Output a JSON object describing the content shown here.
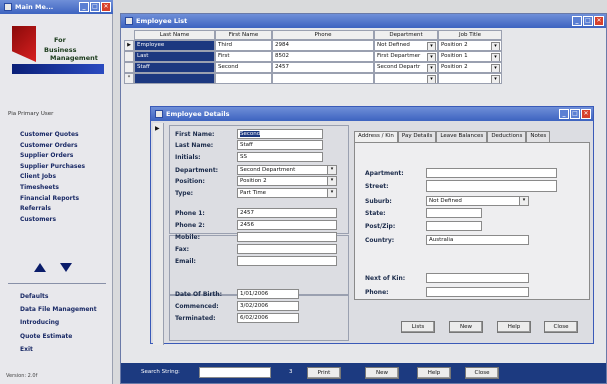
{
  "main": {
    "title": "Main Me...",
    "logo_lines": [
      "For",
      "Business",
      "Management"
    ],
    "user": "Pia Primary User",
    "menu": [
      "Customer Quotes",
      "Customer Orders",
      "Supplier Orders",
      "Supplier Purchases",
      "Client Jobs",
      "Timesheets",
      "Financial Reports",
      "Referrals",
      "Customers"
    ],
    "menu2": [
      "Defaults",
      "Data File Management",
      "Introducing",
      "Quote Estimate",
      "Exit"
    ],
    "version": "Version: 2.0f"
  },
  "list": {
    "title": "Employee List",
    "headers": [
      "Last Name",
      "First Name",
      "Phone",
      "Department",
      "Job Title"
    ],
    "rows": [
      {
        "last": "Employee",
        "first": "Third",
        "phone": "2984",
        "dept": "Not Defined",
        "job": "Position 2"
      },
      {
        "last": "Last",
        "first": "First",
        "phone": "8502",
        "dept": "First Departmer",
        "job": "Position 1"
      },
      {
        "last": "Staff",
        "first": "Second",
        "phone": "2457",
        "dept": "Second Departr",
        "job": "Position 2"
      }
    ],
    "search_label": "Search String:",
    "count": "3",
    "buttons": [
      "Print",
      "New",
      "Help",
      "Close"
    ]
  },
  "details": {
    "title": "Employee Details",
    "labels": {
      "first": "First Name:",
      "last": "Last Name:",
      "initials": "Initials:",
      "dept": "Department:",
      "position": "Position:",
      "type": "Type:",
      "phone1": "Phone 1:",
      "phone2": "Phone 2:",
      "mobile": "Mobile:",
      "fax": "Fax:",
      "email": "Email:",
      "dob": "Date Of Birth:",
      "commenced": "Commenced:",
      "terminated": "Terminated:"
    },
    "values": {
      "first": "Second",
      "last": "Staff",
      "initials": "SS",
      "dept": "Second Department",
      "position": "Position 2",
      "type": "Part Time",
      "phone1": "2457",
      "phone2": "2456",
      "mobile": "",
      "fax": "",
      "email": "",
      "dob": "1/01/2006",
      "commenced": "3/02/2006",
      "terminated": "6/02/2006"
    },
    "tabs": [
      "Address / Kin",
      "Pay Details",
      "Leave Balances",
      "Deductions",
      "Notes"
    ],
    "address_labels": {
      "apartment": "Apartment:",
      "street": "Street:",
      "suburb": "Suburb:",
      "state": "State:",
      "post": "Post/Zip:",
      "country": "Country:",
      "kin": "Next of Kin:",
      "phone": "Phone:"
    },
    "address_values": {
      "apartment": "",
      "street": "",
      "suburb": "Not Defined",
      "state": "",
      "post": "",
      "country": "Australia",
      "kin": "",
      "phone": ""
    },
    "buttons": [
      "Lists",
      "New",
      "Help",
      "Close"
    ]
  }
}
